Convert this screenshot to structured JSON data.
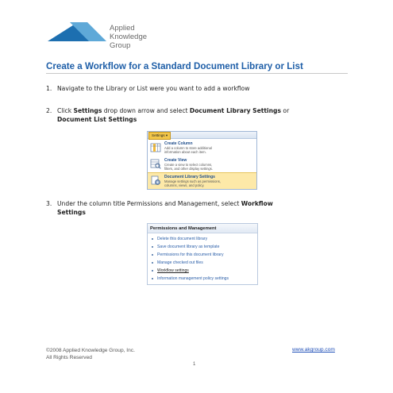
{
  "logo": {
    "line1": "Applied",
    "line2": "Knowledge",
    "line3": "Group"
  },
  "title": "Create a Workflow for a Standard Document Library or List",
  "steps": [
    {
      "num": "1.",
      "text": "Navigate to the Library or List were you want to add a workflow"
    },
    {
      "num": "2.",
      "pre": "Click ",
      "bold1": "Settings",
      "mid": " drop down arrow and select ",
      "bold2": "Document Library Settings",
      "post": " or",
      "line2": "Document List Settings"
    },
    {
      "num": "3.",
      "pre": "Under the column title Permissions and Management, select ",
      "bold1": "Workflow",
      "line2": "Settings"
    }
  ],
  "settings_menu": {
    "button": "Settings ▾",
    "items": [
      {
        "title": "Create Column",
        "desc1": "Add a column to store additional",
        "desc2": "information about each item.",
        "desc3": ""
      },
      {
        "title": "Create View",
        "desc1": "Create a view to select columns,",
        "desc2": "filters, and other display settings.",
        "desc3": ""
      },
      {
        "title": "Document Library Settings",
        "desc1": "Manage settings such as permissions,",
        "desc2": "columns, views, and policy.",
        "desc3": ""
      }
    ]
  },
  "permissions_panel": {
    "header": "Permissions and Management",
    "links": [
      "Delete this document library",
      "Save document library as template",
      "Permissions for this document library",
      "Manage checked out files",
      "Workflow settings",
      "Information management policy settings"
    ]
  },
  "footer": {
    "copyright": "©2008 Applied Knowledge Group, Inc.",
    "rights": "All Rights Reserved",
    "website": "www.akgroup.com",
    "page": "1"
  },
  "colors": {
    "title": "#1f5fa8",
    "logo_blue": "#1d6fb0",
    "logo_light": "#5fa9d8"
  }
}
